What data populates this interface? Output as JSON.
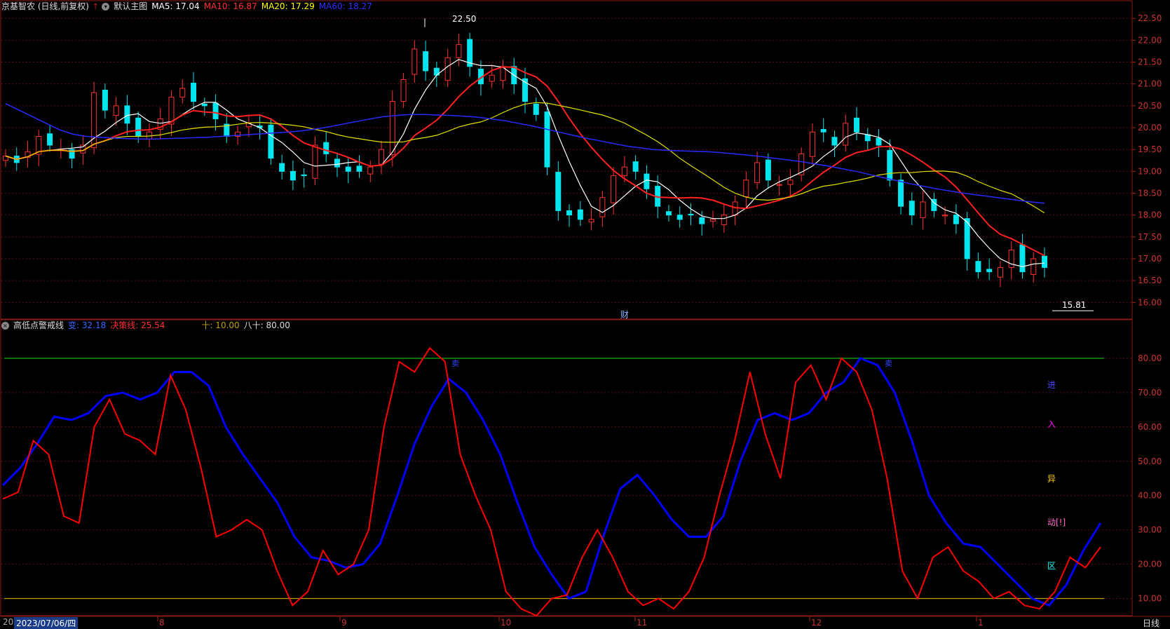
{
  "header": {
    "stock": "京基智农 (日线,前复权)",
    "main_chart": "默认主图",
    "ma": [
      {
        "label": "MA5: 17.04",
        "color": "#ffffff"
      },
      {
        "label": "MA10: 16.87",
        "color": "#ff3030"
      },
      {
        "label": "MA20: 17.29",
        "color": "#ffff00"
      },
      {
        "label": "MA60: 18.27",
        "color": "#3030ff"
      }
    ]
  },
  "sub_header": {
    "name": "高低点警戒线",
    "items": [
      {
        "label": "变: 32.18",
        "color": "#3366ff"
      },
      {
        "label": "决策线: 25.54",
        "color": "#ff3030"
      },
      {
        "label": "十: 10.00",
        "color": "#c0a000"
      },
      {
        "label": "八十: 80.00",
        "color": "#dddddd"
      }
    ]
  },
  "annotations": {
    "high": "22.50",
    "low": "15.81",
    "cai": "财",
    "sell1": "卖",
    "sell2": "卖"
  },
  "side_text": [
    {
      "text": "进",
      "color": "#4444ff"
    },
    {
      "text": "入",
      "color": "#ff00ff"
    },
    {
      "text": "异",
      "color": "#ffcc00"
    },
    {
      "text": "动[!]",
      "color": "#ff66cc"
    },
    {
      "text": "区",
      "color": "#00ffff"
    }
  ],
  "x_axis": {
    "start_date": "2023/07/06/四",
    "left_stub": "20",
    "months": [
      "8",
      "9",
      "10",
      "11",
      "12",
      "1"
    ],
    "period": "日线"
  },
  "chart_data": [
    {
      "type": "candlestick",
      "title": "京基智农 (日线,前复权)",
      "ylim": [
        15.7,
        22.6
      ],
      "y_ticks": [
        16.0,
        16.5,
        17.0,
        17.5,
        18.0,
        18.5,
        19.0,
        19.5,
        20.0,
        20.5,
        21.0,
        21.5,
        22.0,
        22.5
      ],
      "series_ma60": [
        20.55,
        20.4,
        20.25,
        20.1,
        19.95,
        19.85,
        19.8,
        19.78,
        19.76,
        19.75,
        19.74,
        19.74,
        19.75,
        19.76,
        19.77,
        19.78,
        19.8,
        19.82,
        19.84,
        19.86,
        19.88,
        19.9,
        19.93,
        19.97,
        20.02,
        20.08,
        20.14,
        20.2,
        20.25,
        20.28,
        20.3,
        20.3,
        20.29,
        20.28,
        20.26,
        20.24,
        20.2,
        20.16,
        20.1,
        20.04,
        19.97,
        19.9,
        19.83,
        19.76,
        19.7,
        19.64,
        19.58,
        19.54,
        19.5,
        19.48,
        19.47,
        19.46,
        19.45,
        19.43,
        19.4,
        19.37,
        19.34,
        19.3,
        19.26,
        19.22,
        19.17,
        19.12,
        19.06,
        19.0,
        18.93,
        18.86,
        18.79,
        18.72,
        18.66,
        18.6,
        18.55,
        18.5,
        18.46,
        18.42,
        18.38,
        18.34,
        18.3,
        18.27
      ],
      "note": "ma60 values sampled evenly across candles; candles generated from sparse OHLC list"
    },
    {
      "type": "line",
      "title": "高低点警戒线",
      "ylim": [
        5,
        90
      ],
      "y_ticks": [
        10,
        20,
        30,
        40,
        50,
        60,
        70,
        80
      ],
      "reference_lines": [
        {
          "value": 80,
          "color": "#00cc00"
        },
        {
          "value": 10,
          "color": "#c0a000"
        }
      ],
      "series": [
        {
          "name": "变",
          "color": "#0000ff",
          "values": [
            43,
            48,
            55,
            63,
            62,
            64,
            69,
            70,
            68,
            70,
            76,
            76,
            72,
            60,
            52,
            45,
            38,
            28,
            22,
            21,
            19,
            20,
            26,
            40,
            55,
            66,
            74,
            70,
            62,
            52,
            38,
            25,
            17,
            10,
            12,
            28,
            42,
            46,
            40,
            33,
            28,
            28,
            34,
            50,
            62,
            64,
            62,
            64,
            70,
            73,
            80,
            78,
            70,
            56,
            40,
            32,
            26,
            25,
            20,
            15,
            10,
            8,
            14,
            24,
            32
          ]
        },
        {
          "name": "决策线",
          "color": "#ff0000",
          "values": [
            39,
            41,
            56,
            52,
            34,
            32,
            60,
            68,
            58,
            56,
            52,
            75,
            65,
            48,
            28,
            30,
            33,
            30,
            18,
            8,
            12,
            24,
            17,
            20,
            30,
            60,
            79,
            76,
            83,
            79,
            52,
            40,
            30,
            12,
            7,
            5,
            10,
            11,
            22,
            30,
            22,
            12,
            8,
            10,
            7,
            12,
            22,
            40,
            56,
            76,
            58,
            45,
            73,
            78,
            68,
            80,
            76,
            65,
            45,
            18,
            10,
            22,
            25,
            18,
            15,
            10,
            12,
            8,
            7,
            12,
            22,
            19,
            25
          ]
        }
      ],
      "note": "series values sampled evenly left to right"
    }
  ]
}
